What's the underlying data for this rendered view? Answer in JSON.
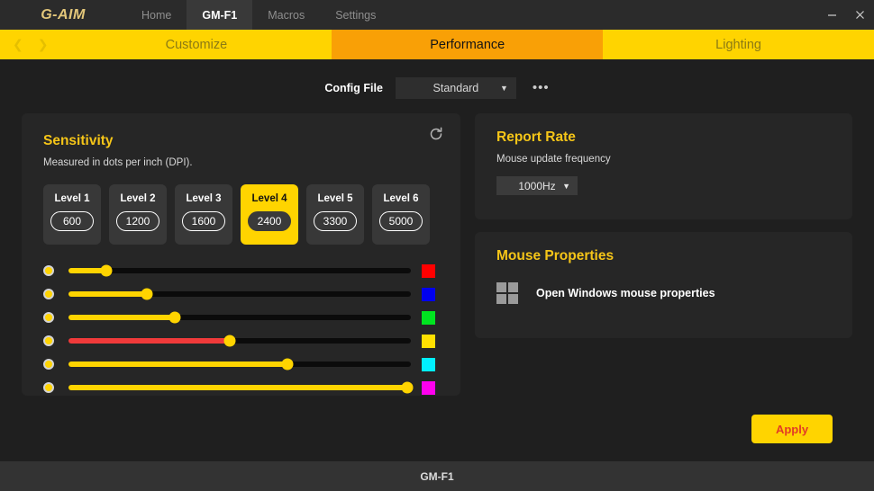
{
  "window": {
    "logo": "G-AIM",
    "minimize_icon": "minimize-icon",
    "close_icon": "close-icon",
    "nav_tabs": [
      {
        "label": "Home",
        "active": false
      },
      {
        "label": "GM-F1",
        "active": true
      },
      {
        "label": "Macros",
        "active": false
      },
      {
        "label": "Settings",
        "active": false
      }
    ]
  },
  "section_bar": {
    "prev_icon": "❮",
    "next_icon": "❯",
    "tabs": [
      {
        "label": "Customize",
        "active": false
      },
      {
        "label": "Performance",
        "active": true
      },
      {
        "label": "Lighting",
        "active": false
      }
    ]
  },
  "config": {
    "label": "Config File",
    "value": "Standard",
    "caret": "▼",
    "more": "•••"
  },
  "sensitivity": {
    "title": "Sensitivity",
    "subtitle": "Measured in dots per inch (DPI).",
    "refresh_icon": "refresh-icon",
    "levels": [
      {
        "name": "Level 1",
        "dpi": "600",
        "active": false
      },
      {
        "name": "Level 2",
        "dpi": "1200",
        "active": false
      },
      {
        "name": "Level 3",
        "dpi": "1600",
        "active": false
      },
      {
        "name": "Level 4",
        "dpi": "2400",
        "active": true
      },
      {
        "name": "Level 5",
        "dpi": "3300",
        "active": false
      },
      {
        "name": "Level 6",
        "dpi": "5000",
        "active": false
      }
    ],
    "sliders": [
      {
        "percent": 11,
        "color": "#ff0000",
        "hot": false
      },
      {
        "percent": 23,
        "color": "#0000ee",
        "hot": false
      },
      {
        "percent": 31,
        "color": "#00e520",
        "hot": false
      },
      {
        "percent": 47,
        "color": "#ffe000",
        "hot": true
      },
      {
        "percent": 64,
        "color": "#00f0ff",
        "hot": false
      },
      {
        "percent": 99,
        "color": "#ff00ee",
        "hot": false
      }
    ]
  },
  "report_rate": {
    "title": "Report Rate",
    "subtitle": "Mouse update frequency",
    "value": "1000Hz",
    "caret": "▼"
  },
  "mouse_properties": {
    "title": "Mouse Properties",
    "icon": "windows-icon",
    "link_label": "Open Windows mouse properties"
  },
  "apply": {
    "label": "Apply"
  },
  "footer": {
    "label": "GM-F1"
  },
  "colors": {
    "accent_yellow": "#ffd400",
    "accent_orange": "#f9a006",
    "title_gold": "#f5c518",
    "apply_text": "#e23b26"
  }
}
